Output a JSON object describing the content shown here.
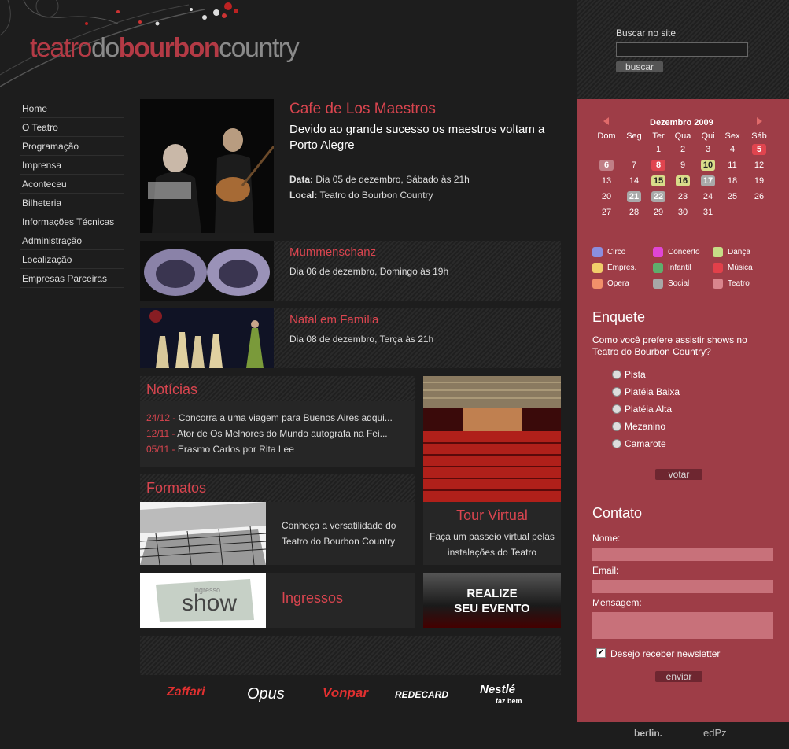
{
  "site": {
    "logo_parts": [
      "teatro",
      "do",
      "bourbon",
      "country"
    ]
  },
  "search": {
    "label": "Buscar no site",
    "value": "",
    "button": "buscar"
  },
  "nav": [
    "Home",
    "O Teatro",
    "Programação",
    "Imprensa",
    "Aconteceu",
    "Bilheteria",
    "Informações Técnicas",
    "Administração",
    "Localização",
    "Empresas Parceiras"
  ],
  "featured": {
    "title": "Cafe de Los Maestros",
    "subtitle": "Devido ao grande sucesso os maestros voltam a Porto Alegre",
    "date_label": "Data:",
    "date_value": "Dia 05 de dezembro, Sábado às 21h",
    "place_label": "Local:",
    "place_value": "Teatro do Bourbon Country"
  },
  "events": [
    {
      "title": "Mummenschanz",
      "date": "Dia 06 de dezembro, Domingo às 19h"
    },
    {
      "title": "Natal em Família",
      "date": "Dia 08 de dezembro, Terça às 21h"
    }
  ],
  "news": {
    "title": "Notícias",
    "items": [
      {
        "date": "24/12 -",
        "text": "Concorra a uma viagem para Buenos Aires adqui..."
      },
      {
        "date": "12/11 -",
        "text": "Ator de Os Melhores do Mundo autografa na Fei..."
      },
      {
        "date": "05/11 -",
        "text": "Erasmo Carlos por Rita Lee"
      }
    ]
  },
  "formatos": {
    "title": "Formatos",
    "text": "Conheça a versatilidade do Teatro do Bourbon Country"
  },
  "tour": {
    "title": "Tour Virtual",
    "text": "Faça um passeio virtual pelas instalações do Teatro"
  },
  "ingressos": {
    "title": "Ingressos",
    "logo_small": "ingresso",
    "logo_big": "show"
  },
  "realize": {
    "line1": "REALIZE",
    "line2": "SEU EVENTO"
  },
  "partners": [
    "Zaffari",
    "Opus",
    "Vonpar",
    "REDECARD",
    "Nestlé",
    "faz bem"
  ],
  "calendar": {
    "month": "Dezembro 2009",
    "weekdays": [
      "Dom",
      "Seg",
      "Ter",
      "Qua",
      "Qui",
      "Sex",
      "Sáb"
    ],
    "weeks": [
      [
        "",
        "",
        "1",
        "2",
        "3",
        "4",
        "5"
      ],
      [
        "6",
        "7",
        "8",
        "9",
        "10",
        "11",
        "12"
      ],
      [
        "13",
        "14",
        "15",
        "16",
        "17",
        "18",
        "19"
      ],
      [
        "20",
        "21",
        "22",
        "23",
        "24",
        "25",
        "26"
      ],
      [
        "27",
        "28",
        "29",
        "30",
        "31",
        "",
        ""
      ]
    ],
    "marked": {
      "5": "#e0454f",
      "6": "#c07f86",
      "8": "#e0454f",
      "10": "#d9dc8a",
      "15": "#d9dc8a",
      "16": "#d9dc8a",
      "17": "#a9a9a9",
      "21": "#a9a9a9",
      "22": "#a9a9a9"
    }
  },
  "legend": [
    {
      "label": "Circo",
      "color": "#8b8ede"
    },
    {
      "label": "Concerto",
      "color": "#e045d6"
    },
    {
      "label": "Dança",
      "color": "#c6dd87"
    },
    {
      "label": "Empres.",
      "color": "#f1cd6a"
    },
    {
      "label": "Infantil",
      "color": "#5fae6c"
    },
    {
      "label": "Música",
      "color": "#e2404a"
    },
    {
      "label": "Ópera",
      "color": "#f1906a"
    },
    {
      "label": "Social",
      "color": "#a7a7a7"
    },
    {
      "label": "Teatro",
      "color": "#d9858d"
    }
  ],
  "poll": {
    "title": "Enquete",
    "question": "Como você prefere assistir shows no Teatro do Bourbon Country?",
    "options": [
      "Pista",
      "Platéia Baixa",
      "Platéia Alta",
      "Mezanino",
      "Camarote"
    ],
    "button": "votar"
  },
  "contact": {
    "title": "Contato",
    "name_label": "Nome:",
    "email_label": "Email:",
    "message_label": "Mensagem:",
    "newsletter_label": "Desejo receber newsletter",
    "button": "enviar"
  },
  "credits": [
    "berlin.",
    "edPz"
  ]
}
